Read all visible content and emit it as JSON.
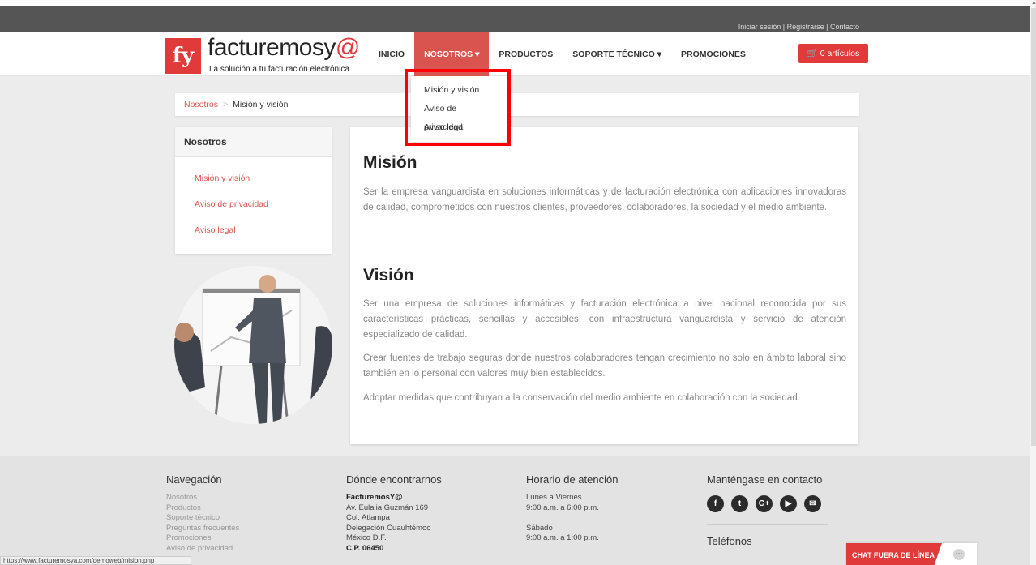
{
  "topbar": {
    "links": "Iniciar sesión | Registrarse | Contacto"
  },
  "header": {
    "logo_mark": "fy",
    "logo_name_main": "facturemosy",
    "logo_name_accent": "@",
    "tagline": "La solución a tu facturación electrónica",
    "nav": [
      "INICIO",
      "NOSOTROS ▾",
      "PRODUCTOS",
      "SOPORTE TÉCNICO ▾",
      "PROMOCIONES"
    ],
    "cart": "🛒 0 artículos"
  },
  "dropdown": [
    "Misión y visión",
    "Aviso de privacidad",
    "Aviso legal"
  ],
  "breadcrumb": {
    "parent": "Nosotros",
    "sep": ">",
    "current": "Misión y visión"
  },
  "sidebar": {
    "title": "Nosotros",
    "links": [
      "Misión y visión",
      "Aviso de privacidad",
      "Aviso legal"
    ]
  },
  "content": {
    "mision_title": "Misión",
    "mision_text": "Ser la empresa vanguardista en soluciones informáticas y de facturación electrónica con aplicaciones innovadoras de calidad, comprometidos con nuestros clientes, proveedores, colaboradores, la sociedad y el medio ambiente.",
    "vision_title": "Visión",
    "vision_p1": "Ser una empresa de soluciones informáticas y facturación electrónica a nivel nacional reconocida por sus características prácticas, sencillas y accesibles, con infraestructura vanguardista y servicio de atención especializado de calidad.",
    "vision_p2": "Crear fuentes de trabajo seguras donde nuestros colaboradores tengan crecimiento no solo en ámbito laboral sino también en lo personal con valores muy bien establecidos.",
    "vision_p3": "Adoptar medidas que contribuyan a la conservación del medio ambiente en colaboración con la sociedad."
  },
  "footer": {
    "nav_title": "Navegación",
    "nav_links": [
      "Nosotros",
      "Productos",
      "Soporte técnico",
      "Preguntas frecuentes",
      "Promociones",
      "Aviso de privacidad"
    ],
    "where_title": "Dónde encontrarnos",
    "where_lines": [
      "FacturemosY@",
      "Av. Eulalia Guzmán 169",
      "Col. Atlampa",
      "Delegación Cuauhtémoc",
      "México D.F.",
      "C.P. 06450"
    ],
    "hours_title": "Horario de atención",
    "hours_lines": [
      "Lunes a Viernes",
      "9:00 a.m. a 6:00 p.m.",
      "",
      "Sábado",
      "9:00 a.m. a 1:00 p.m."
    ],
    "contact_title": "Manténgase en contacto",
    "social": [
      "f",
      "t",
      "G+",
      "▶",
      "✉"
    ],
    "phones_title": "Teléfonos"
  },
  "chat": {
    "label": "CHAT FUERA DE LÍNEA",
    "dots": "···"
  },
  "status_url": "https://www.facturemosya.com/demoweb/mision.php",
  "colors": {
    "accent": "#e03a3a",
    "nav_active": "#d9534f"
  }
}
